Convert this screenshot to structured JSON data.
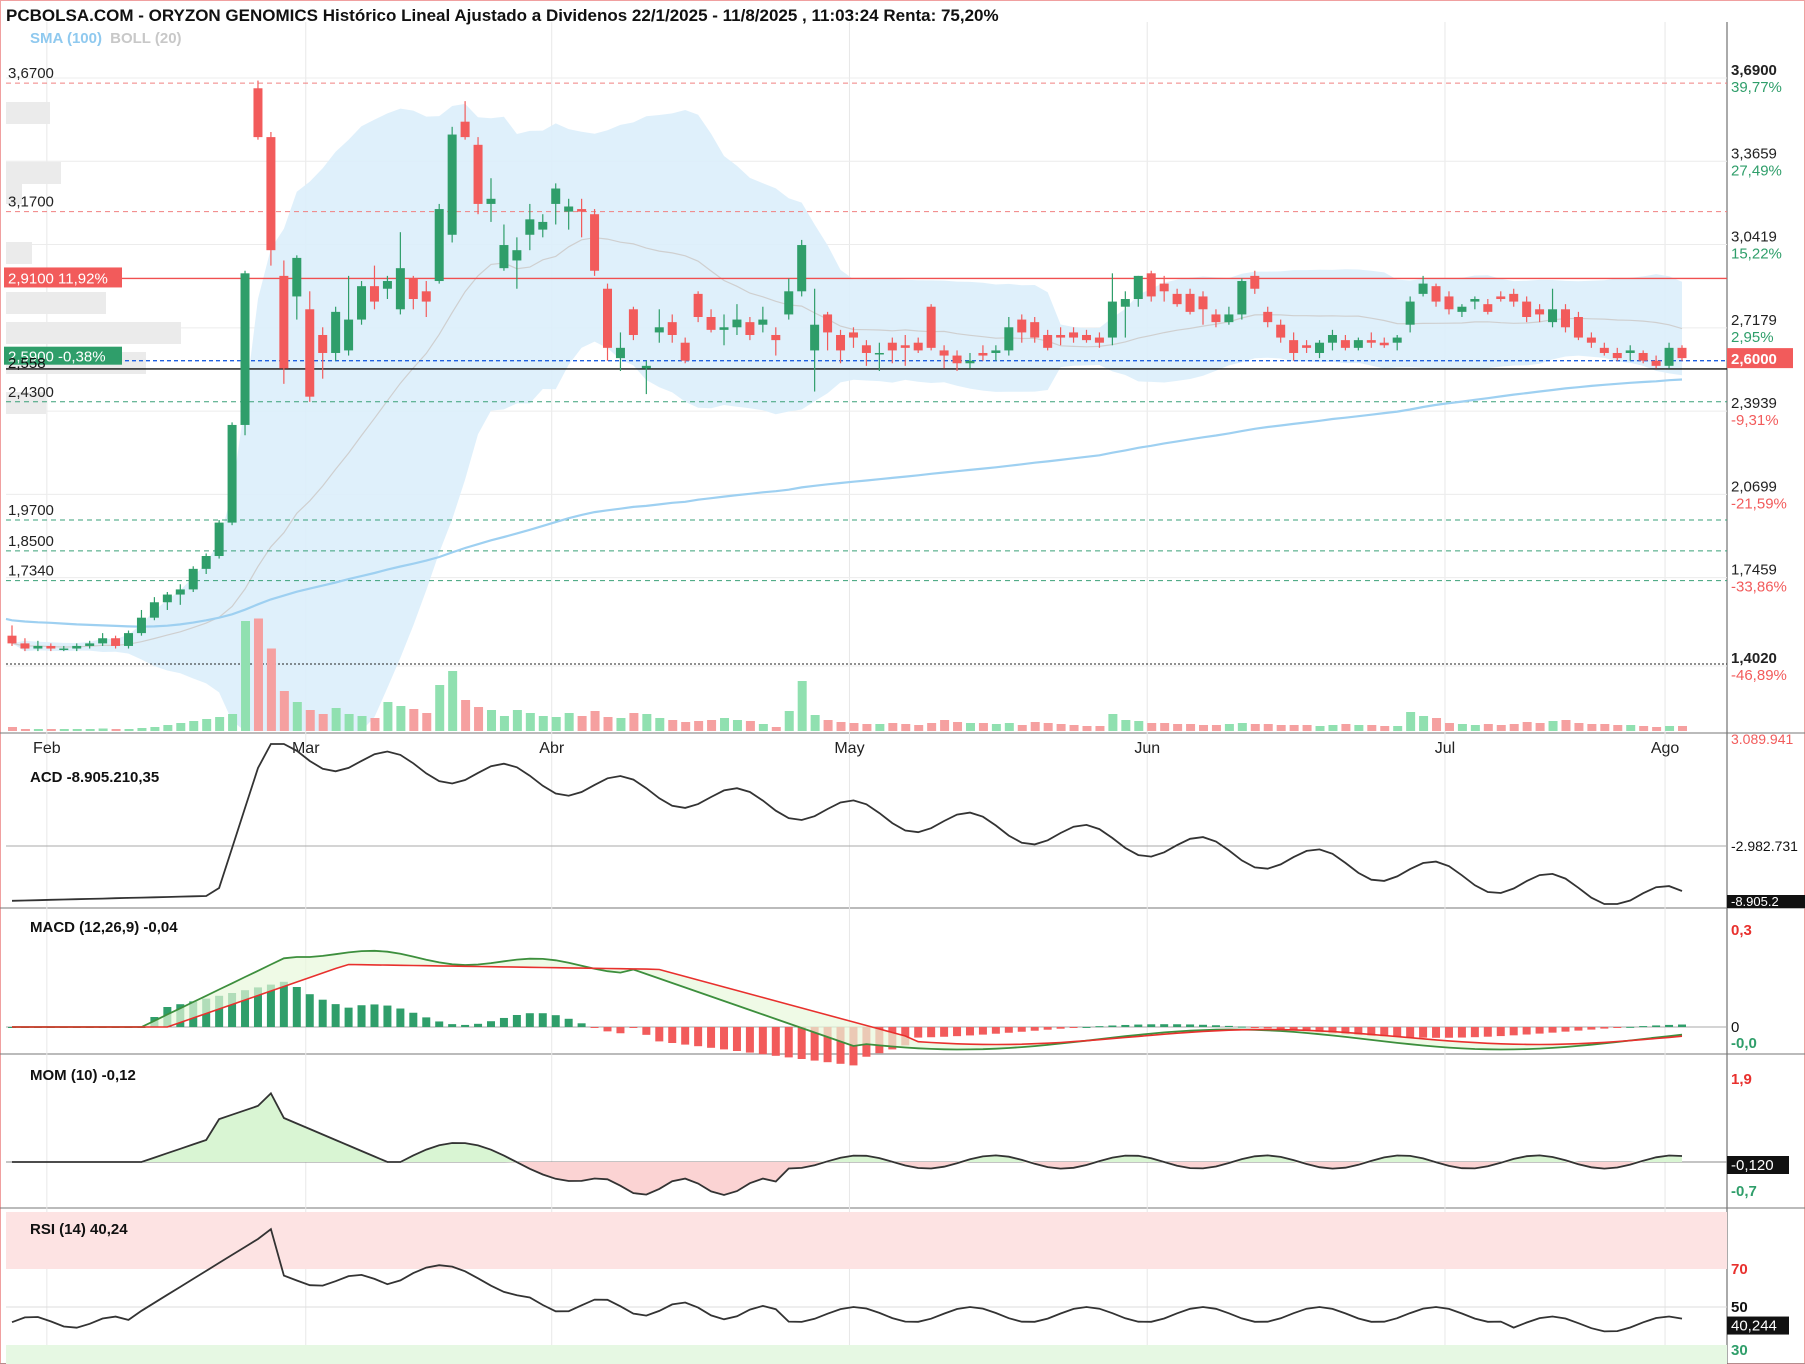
{
  "header": {
    "title": "PCBOLSA.COM - ORYZON GENOMICS Histórico Lineal Ajustado a Dividenos 22/1/2025 - 11/8/2025 , 11:03:24 Renta: 75,20%",
    "legend_sma": "SMA (100)",
    "legend_boll": "BOLL (20)"
  },
  "colors": {
    "up": "#2f9e6a",
    "down": "#f25b5b",
    "sma": "#9ed0f1",
    "boll_fill": "#dbeefb",
    "boll_mid": "#cfcfcf",
    "macd_line": "#3d8f3d",
    "macd_signal": "#e8302d",
    "ind_line": "#333333",
    "pos_fill": "#d9f5d3",
    "neg_fill": "#fbd3d3",
    "rsi_over": "#fde3e3",
    "rsi_under": "#e6f8e3"
  },
  "chart_data": {
    "type": "candlestick",
    "x_months": [
      "Feb",
      "Mar",
      "Abr",
      "May",
      "Jun",
      "Jul",
      "Ago"
    ],
    "y_range": [
      1.402,
      3.69
    ],
    "right_axis": [
      {
        "value": "3,6900",
        "pct": "39,77%",
        "pos": true
      },
      {
        "value": "3,3659",
        "pct": "27,49%",
        "pos": true
      },
      {
        "value": "3,0419",
        "pct": "15,22%",
        "pos": true
      },
      {
        "value": "2,7179",
        "pct": "2,95%",
        "pos": true
      },
      {
        "value": "2,3939",
        "pct": "-9,31%",
        "pos": false
      },
      {
        "value": "2,0699",
        "pct": "-21,59%",
        "pos": false
      },
      {
        "value": "1,7459",
        "pct": "-33,86%",
        "pos": false
      },
      {
        "value": "1,4020",
        "pct": "-46,89%",
        "pos": false
      }
    ],
    "left_levels": [
      {
        "label": "3,6700",
        "value": 3.67,
        "style": "red"
      },
      {
        "label": "3,1700",
        "value": 3.17,
        "style": "red"
      },
      {
        "label": "2,4300",
        "value": 2.43,
        "style": "green"
      },
      {
        "label": "1,9700",
        "value": 1.97,
        "style": "green"
      },
      {
        "label": "1,8500",
        "value": 1.85,
        "style": "green"
      },
      {
        "label": "1,7340",
        "value": 1.734,
        "style": "green"
      }
    ],
    "ref_red": {
      "label": "2,9100",
      "pct": "11,92%",
      "value": 2.91
    },
    "ref_green": {
      "label": "2,5900",
      "pct": "-0,38%",
      "value": 2.59
    },
    "ref_black": {
      "label": "2,558",
      "value": 2.558
    },
    "last_price": "2,6000",
    "candles": [
      [
        1.52,
        1.56,
        1.48,
        1.49
      ],
      [
        1.49,
        1.51,
        1.46,
        1.47
      ],
      [
        1.47,
        1.5,
        1.46,
        1.48
      ],
      [
        1.48,
        1.49,
        1.46,
        1.47
      ],
      [
        1.47,
        1.48,
        1.46,
        1.47
      ],
      [
        1.47,
        1.49,
        1.46,
        1.48
      ],
      [
        1.48,
        1.5,
        1.47,
        1.49
      ],
      [
        1.49,
        1.53,
        1.48,
        1.51
      ],
      [
        1.51,
        1.52,
        1.47,
        1.48
      ],
      [
        1.48,
        1.54,
        1.47,
        1.53
      ],
      [
        1.53,
        1.62,
        1.52,
        1.59
      ],
      [
        1.59,
        1.67,
        1.58,
        1.65
      ],
      [
        1.65,
        1.69,
        1.62,
        1.68
      ],
      [
        1.68,
        1.72,
        1.64,
        1.7
      ],
      [
        1.7,
        1.79,
        1.69,
        1.78
      ],
      [
        1.78,
        1.84,
        1.76,
        1.83
      ],
      [
        1.83,
        1.97,
        1.82,
        1.96
      ],
      [
        1.96,
        2.35,
        1.95,
        2.34
      ],
      [
        2.34,
        2.94,
        2.3,
        2.93
      ],
      [
        3.65,
        3.68,
        3.45,
        3.46
      ],
      [
        3.46,
        3.48,
        2.96,
        3.02
      ],
      [
        2.92,
        2.98,
        2.5,
        2.56
      ],
      [
        2.84,
        3.0,
        2.75,
        2.99
      ],
      [
        2.79,
        2.86,
        2.43,
        2.45
      ],
      [
        2.69,
        2.72,
        2.52,
        2.62
      ],
      [
        2.62,
        2.8,
        2.59,
        2.78
      ],
      [
        2.63,
        2.92,
        2.61,
        2.75
      ],
      [
        2.75,
        2.9,
        2.73,
        2.88
      ],
      [
        2.88,
        2.96,
        2.79,
        2.82
      ],
      [
        2.87,
        2.92,
        2.83,
        2.9
      ],
      [
        2.79,
        3.09,
        2.77,
        2.95
      ],
      [
        2.91,
        2.92,
        2.79,
        2.83
      ],
      [
        2.86,
        2.9,
        2.76,
        2.82
      ],
      [
        2.9,
        3.2,
        2.89,
        3.18
      ],
      [
        3.08,
        3.5,
        3.05,
        3.47
      ],
      [
        3.52,
        3.6,
        3.45,
        3.46
      ],
      [
        3.43,
        3.46,
        3.16,
        3.2
      ],
      [
        3.2,
        3.3,
        3.13,
        3.22
      ],
      [
        2.95,
        3.12,
        2.94,
        3.04
      ],
      [
        2.98,
        3.07,
        2.87,
        3.02
      ],
      [
        3.08,
        3.2,
        3.02,
        3.14
      ],
      [
        3.1,
        3.16,
        3.07,
        3.13
      ],
      [
        3.2,
        3.28,
        3.12,
        3.26
      ],
      [
        3.17,
        3.22,
        3.1,
        3.19
      ],
      [
        3.18,
        3.22,
        3.07,
        3.17
      ],
      [
        3.16,
        3.18,
        2.92,
        2.94
      ],
      [
        2.87,
        2.89,
        2.59,
        2.64
      ],
      [
        2.6,
        2.7,
        2.55,
        2.64
      ],
      [
        2.79,
        2.8,
        2.67,
        2.69
      ],
      [
        2.56,
        2.59,
        2.46,
        2.57
      ],
      [
        2.7,
        2.79,
        2.66,
        2.72
      ],
      [
        2.74,
        2.77,
        2.66,
        2.69
      ],
      [
        2.66,
        2.68,
        2.58,
        2.59
      ],
      [
        2.85,
        2.86,
        2.74,
        2.76
      ],
      [
        2.76,
        2.79,
        2.7,
        2.71
      ],
      [
        2.71,
        2.77,
        2.65,
        2.72
      ],
      [
        2.72,
        2.81,
        2.69,
        2.75
      ],
      [
        2.74,
        2.76,
        2.67,
        2.69
      ],
      [
        2.73,
        2.8,
        2.7,
        2.75
      ],
      [
        2.69,
        2.72,
        2.61,
        2.67
      ],
      [
        2.77,
        2.91,
        2.75,
        2.86
      ],
      [
        2.86,
        3.06,
        2.84,
        3.04
      ],
      [
        2.63,
        2.87,
        2.47,
        2.73
      ],
      [
        2.77,
        2.78,
        2.63,
        2.7
      ],
      [
        2.69,
        2.71,
        2.58,
        2.63
      ],
      [
        2.7,
        2.72,
        2.64,
        2.68
      ],
      [
        2.65,
        2.67,
        2.57,
        2.62
      ],
      [
        2.62,
        2.66,
        2.55,
        2.62
      ],
      [
        2.66,
        2.68,
        2.58,
        2.63
      ],
      [
        2.65,
        2.69,
        2.57,
        2.64
      ],
      [
        2.66,
        2.68,
        2.62,
        2.63
      ],
      [
        2.8,
        2.81,
        2.63,
        2.64
      ],
      [
        2.63,
        2.65,
        2.56,
        2.61
      ],
      [
        2.61,
        2.63,
        2.55,
        2.58
      ],
      [
        2.58,
        2.62,
        2.56,
        2.59
      ],
      [
        2.62,
        2.65,
        2.59,
        2.61
      ],
      [
        2.62,
        2.65,
        2.59,
        2.63
      ],
      [
        2.63,
        2.76,
        2.61,
        2.72
      ],
      [
        2.75,
        2.77,
        2.66,
        2.7
      ],
      [
        2.74,
        2.76,
        2.66,
        2.68
      ],
      [
        2.69,
        2.71,
        2.63,
        2.64
      ],
      [
        2.69,
        2.72,
        2.65,
        2.68
      ],
      [
        2.7,
        2.72,
        2.66,
        2.68
      ],
      [
        2.69,
        2.71,
        2.66,
        2.67
      ],
      [
        2.68,
        2.7,
        2.64,
        2.66
      ],
      [
        2.68,
        2.93,
        2.65,
        2.82
      ],
      [
        2.8,
        2.86,
        2.68,
        2.83
      ],
      [
        2.83,
        2.92,
        2.8,
        2.92
      ],
      [
        2.93,
        2.94,
        2.82,
        2.84
      ],
      [
        2.89,
        2.92,
        2.82,
        2.86
      ],
      [
        2.85,
        2.87,
        2.8,
        2.81
      ],
      [
        2.85,
        2.87,
        2.77,
        2.78
      ],
      [
        2.84,
        2.86,
        2.73,
        2.79
      ],
      [
        2.77,
        2.79,
        2.72,
        2.74
      ],
      [
        2.74,
        2.8,
        2.73,
        2.77
      ],
      [
        2.77,
        2.91,
        2.75,
        2.9
      ],
      [
        2.92,
        2.94,
        2.85,
        2.87
      ],
      [
        2.78,
        2.8,
        2.72,
        2.74
      ],
      [
        2.73,
        2.75,
        2.66,
        2.68
      ],
      [
        2.67,
        2.7,
        2.59,
        2.62
      ],
      [
        2.65,
        2.67,
        2.62,
        2.64
      ],
      [
        2.62,
        2.67,
        2.6,
        2.66
      ],
      [
        2.66,
        2.71,
        2.63,
        2.69
      ],
      [
        2.67,
        2.69,
        2.63,
        2.64
      ],
      [
        2.64,
        2.68,
        2.63,
        2.67
      ],
      [
        2.67,
        2.7,
        2.64,
        2.66
      ],
      [
        2.66,
        2.68,
        2.64,
        2.65
      ],
      [
        2.66,
        2.69,
        2.63,
        2.68
      ],
      [
        2.73,
        2.84,
        2.7,
        2.82
      ],
      [
        2.85,
        2.92,
        2.84,
        2.89
      ],
      [
        2.88,
        2.89,
        2.8,
        2.82
      ],
      [
        2.84,
        2.86,
        2.77,
        2.79
      ],
      [
        2.78,
        2.81,
        2.76,
        2.8
      ],
      [
        2.82,
        2.84,
        2.79,
        2.83
      ],
      [
        2.81,
        2.83,
        2.77,
        2.78
      ],
      [
        2.84,
        2.86,
        2.82,
        2.83
      ],
      [
        2.85,
        2.87,
        2.8,
        2.82
      ],
      [
        2.82,
        2.84,
        2.74,
        2.76
      ],
      [
        2.79,
        2.81,
        2.74,
        2.77
      ],
      [
        2.74,
        2.87,
        2.72,
        2.79
      ],
      [
        2.79,
        2.81,
        2.7,
        2.72
      ],
      [
        2.76,
        2.78,
        2.67,
        2.68
      ],
      [
        2.68,
        2.7,
        2.64,
        2.66
      ],
      [
        2.64,
        2.66,
        2.61,
        2.62
      ],
      [
        2.62,
        2.64,
        2.59,
        2.6
      ],
      [
        2.62,
        2.65,
        2.59,
        2.63
      ],
      [
        2.62,
        2.63,
        2.58,
        2.59
      ],
      [
        2.59,
        2.61,
        2.56,
        2.57
      ],
      [
        2.57,
        2.66,
        2.56,
        2.64
      ],
      [
        2.64,
        2.65,
        2.59,
        2.6
      ]
    ],
    "volumes": [
      8,
      4,
      4,
      4,
      4,
      4,
      4,
      5,
      4,
      4,
      6,
      8,
      12,
      16,
      20,
      24,
      28,
      34,
      220,
      225,
      165,
      80,
      58,
      42,
      34,
      46,
      34,
      30,
      26,
      58,
      50,
      44,
      36,
      92,
      120,
      62,
      48,
      42,
      30,
      42,
      36,
      30,
      28,
      36,
      30,
      40,
      28,
      26,
      36,
      34,
      26,
      22,
      18,
      20,
      22,
      26,
      22,
      20,
      14,
      8,
      40,
      100,
      32,
      22,
      18,
      16,
      14,
      14,
      16,
      14,
      12,
      16,
      22,
      18,
      16,
      16,
      14,
      16,
      12,
      18,
      16,
      14,
      12,
      10,
      10,
      34,
      22,
      20,
      16,
      16,
      14,
      14,
      12,
      12,
      14,
      16,
      14,
      14,
      12,
      12,
      12,
      10,
      12,
      14,
      12,
      12,
      10,
      10,
      38,
      30,
      26,
      16,
      14,
      12,
      14,
      12,
      14,
      18,
      16,
      20,
      22,
      16,
      14,
      14,
      12,
      12,
      10,
      8,
      10,
      10
    ],
    "sma100": [
      1.58,
      1.575,
      1.572,
      1.57,
      1.567,
      1.564,
      1.562,
      1.56,
      1.558,
      1.556,
      1.555,
      1.556,
      1.559,
      1.564,
      1.571,
      1.58,
      1.59,
      1.603,
      1.621,
      1.642,
      1.661,
      1.676,
      1.691,
      1.703,
      1.715,
      1.727,
      1.74,
      1.752,
      1.764,
      1.777,
      1.789,
      1.8,
      1.812,
      1.826,
      1.844,
      1.861,
      1.876,
      1.891,
      1.904,
      1.918,
      1.932,
      1.947,
      1.962,
      1.977,
      1.99,
      2.001,
      2.008,
      2.014,
      2.021,
      2.025,
      2.031,
      2.037,
      2.041,
      2.049,
      2.055,
      2.061,
      2.067,
      2.072,
      2.078,
      2.082,
      2.088,
      2.097,
      2.103,
      2.109,
      2.114,
      2.119,
      2.124,
      2.129,
      2.134,
      2.139,
      2.144,
      2.15,
      2.155,
      2.16,
      2.165,
      2.17,
      2.175,
      2.181,
      2.187,
      2.193,
      2.198,
      2.204,
      2.21,
      2.216,
      2.222,
      2.232,
      2.241,
      2.251,
      2.259,
      2.268,
      2.276,
      2.284,
      2.292,
      2.299,
      2.307,
      2.316,
      2.325,
      2.332,
      2.338,
      2.344,
      2.35,
      2.356,
      2.363,
      2.368,
      2.374,
      2.38,
      2.386,
      2.392,
      2.4,
      2.41,
      2.418,
      2.425,
      2.431,
      2.438,
      2.444,
      2.451,
      2.458,
      2.464,
      2.47,
      2.476,
      2.482,
      2.487,
      2.492,
      2.496,
      2.5,
      2.504,
      2.507,
      2.51,
      2.514,
      2.517
    ]
  },
  "panels": {
    "acd": {
      "label": "ACD",
      "value": "-8.905.210,35",
      "ticks": [
        "3.089.941",
        "-2.982.731",
        "-8.905.2"
      ]
    },
    "macd": {
      "label": "MACD (12,26,9)",
      "value": "-0,04",
      "ticks": [
        "0,3",
        "0",
        "-0,0"
      ]
    },
    "mom": {
      "label": "MOM (10)",
      "value": "-0,12",
      "ticks": [
        "1,9",
        "-0,120",
        "-0,7"
      ]
    },
    "rsi": {
      "label": "RSI (14)",
      "value": "40,24",
      "ticks": [
        "70",
        "50",
        "40,244",
        "30"
      ]
    }
  }
}
